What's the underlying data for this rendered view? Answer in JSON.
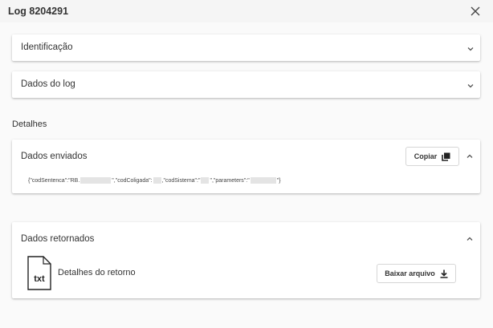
{
  "dialog": {
    "title": "Log 8204291",
    "close_icon": "close-icon"
  },
  "panels": {
    "identificacao": {
      "title": "Identificação",
      "icon": "chevron-down-icon"
    },
    "dados_log": {
      "title": "Dados do log",
      "icon": "chevron-down-icon"
    }
  },
  "details": {
    "label": "Detalhes",
    "enviados": {
      "title": "Dados enviados",
      "copy_label": "Copiar",
      "copy_icon": "copy-icon",
      "toggle_icon": "chevron-up-icon",
      "json": {
        "p1": "{\"codSentenca\":\"RB.",
        "p2": "\",\"codColigada\":",
        "p3": ",\"codSistema\":\"",
        "p4": "\",\"parameters\":\"",
        "p5": "\"}"
      }
    },
    "retornados": {
      "title": "Dados retornados",
      "toggle_icon": "chevron-up-icon",
      "file_icon_text": "txt",
      "file_label": "Detalhes do retorno",
      "download_label": "Baixar arquivo",
      "download_icon": "download-icon"
    }
  }
}
